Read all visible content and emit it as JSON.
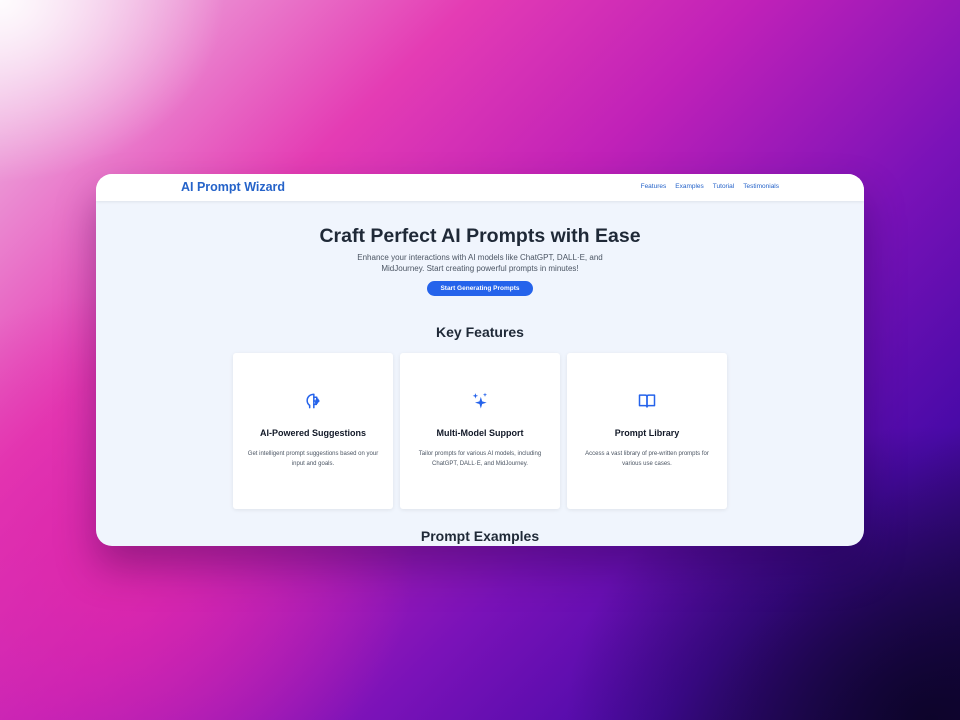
{
  "brand": "AI Prompt Wizard",
  "nav": {
    "links": [
      "Features",
      "Examples",
      "Tutorial",
      "Testimonials"
    ]
  },
  "hero": {
    "title": "Craft Perfect AI Prompts with Ease",
    "description": "Enhance your interactions with AI models like ChatGPT, DALL·E, and MidJourney. Start creating powerful prompts in minutes!",
    "cta_label": "Start Generating Prompts"
  },
  "features": {
    "heading": "Key Features",
    "cards": [
      {
        "icon": "brain-icon",
        "title": "AI-Powered Suggestions",
        "description": "Get intelligent prompt suggestions based on your input and goals."
      },
      {
        "icon": "sparkles-icon",
        "title": "Multi-Model Support",
        "description": "Tailor prompts for various AI models, including ChatGPT, DALL·E, and MidJourney."
      },
      {
        "icon": "book-open-icon",
        "title": "Prompt Library",
        "description": "Access a vast library of pre-written prompts for various use cases."
      }
    ]
  },
  "examples": {
    "heading": "Prompt Examples"
  },
  "colors": {
    "accent": "#2563eb",
    "brand": "#2563c9",
    "page_background": "#f0f5fd"
  }
}
